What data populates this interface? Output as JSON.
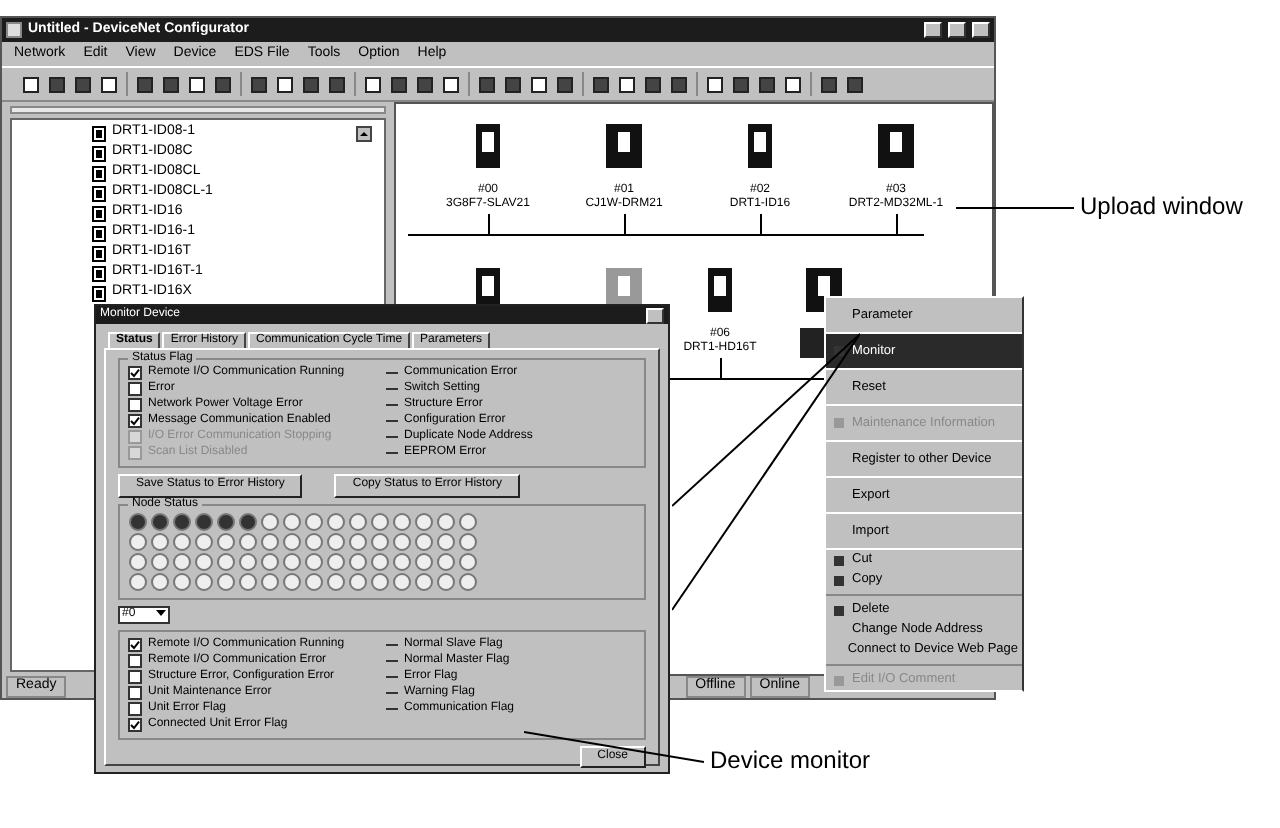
{
  "window": {
    "title": "Untitled - DeviceNet Configurator"
  },
  "menu": [
    "Network",
    "Edit",
    "View",
    "Device",
    "EDS File",
    "Tools",
    "Option",
    "Help"
  ],
  "tree": {
    "items": [
      {
        "label": "DRT1-ID08-1"
      },
      {
        "label": "DRT1-ID08C"
      },
      {
        "label": "DRT1-ID08CL"
      },
      {
        "label": "DRT1-ID08CL-1"
      },
      {
        "label": "DRT1-ID16"
      },
      {
        "label": "DRT1-ID16-1"
      },
      {
        "label": "DRT1-ID16T"
      },
      {
        "label": "DRT1-ID16T-1"
      },
      {
        "label": "DRT1-ID16X"
      }
    ]
  },
  "network": {
    "rows": [
      [
        {
          "address": "#00",
          "name": "3G8F7-SLAV21",
          "selected": false
        },
        {
          "address": "#01",
          "name": "CJ1W-DRM21",
          "selected": false
        },
        {
          "address": "#02",
          "name": "DRT1-ID16",
          "selected": false
        },
        {
          "address": "#03",
          "name": "DRT2-MD32ML-1",
          "selected": false
        }
      ],
      [
        {
          "selected": false
        },
        {
          "selected": false
        },
        {
          "address": "#06",
          "name": "DRT1-HD16T",
          "selected": false
        },
        {
          "selected": true
        }
      ]
    ]
  },
  "status_bar": [
    "Ready",
    "Offline",
    "Online"
  ],
  "monitor": {
    "title": "Monitor Device",
    "tabs": [
      {
        "label": "Status",
        "selected": true
      },
      {
        "label": "Error History",
        "selected": false
      },
      {
        "label": "Communication Cycle Time",
        "selected": false
      },
      {
        "label": "Parameters",
        "selected": false
      }
    ],
    "status_group": {
      "title": "Status Flag",
      "left": [
        {
          "label": "Remote I/O Communication Running",
          "checked": true,
          "disabled": false
        },
        {
          "label": "Error",
          "checked": false,
          "disabled": false
        },
        {
          "label": "Network Power Voltage Error",
          "checked": false,
          "disabled": false
        },
        {
          "label": "Message Communication Enabled",
          "checked": true,
          "disabled": false
        },
        {
          "label": "I/O Error Communication Stopping",
          "checked": false,
          "disabled": true
        },
        {
          "label": "Scan List Disabled",
          "checked": false,
          "disabled": true
        }
      ],
      "right": [
        "Communication Error",
        "Switch Setting",
        "Structure Error",
        "Configuration Error",
        "Duplicate Node Address",
        "EEPROM Error"
      ]
    },
    "buttons": [
      "Save Status to Error History",
      "Copy Status to Error History"
    ],
    "node_group": {
      "title": "Node Status"
    },
    "node_select": {
      "value": "#0"
    },
    "node_flags": {
      "left": [
        {
          "label": "Remote I/O Communication Running",
          "checked": true,
          "disabled": false
        },
        {
          "label": "Remote I/O Communication Error",
          "checked": false,
          "disabled": false
        },
        {
          "label": "Structure Error, Configuration Error",
          "checked": false,
          "disabled": false
        },
        {
          "label": "Unit Maintenance Error",
          "checked": false,
          "disabled": false
        },
        {
          "label": "Unit Error Flag",
          "checked": false,
          "disabled": false
        },
        {
          "label": "Connected Unit Error Flag",
          "checked": true,
          "disabled": false
        }
      ],
      "right": [
        "Normal Slave Flag",
        "Normal Master Flag",
        "Error Flag",
        "Warning Flag",
        "Communication Flag"
      ]
    },
    "close": "Close"
  },
  "context_menu": {
    "items": [
      {
        "label": "Parameter",
        "kind": "item",
        "icon": false,
        "selected": false,
        "disabled": false
      },
      {
        "label": "Monitor",
        "kind": "item",
        "icon": true,
        "selected": true,
        "disabled": false
      },
      {
        "label": "Reset",
        "kind": "item",
        "icon": false,
        "selected": false,
        "disabled": false
      },
      {
        "label": "Maintenance Information",
        "kind": "item",
        "icon": true,
        "selected": false,
        "disabled": true
      },
      {
        "label": "Register to other Device",
        "kind": "item",
        "icon": false,
        "selected": false,
        "disabled": false
      },
      {
        "label": "Export",
        "kind": "item",
        "icon": false,
        "selected": false,
        "disabled": false
      },
      {
        "label": "Import",
        "kind": "item",
        "icon": false,
        "selected": false,
        "disabled": false
      },
      {
        "label": "Cut",
        "kind": "compact",
        "icon": true,
        "selected": false,
        "disabled": false
      },
      {
        "label": "Copy",
        "kind": "compact",
        "icon": true,
        "selected": false,
        "disabled": false
      },
      {
        "kind": "separator"
      },
      {
        "label": "Delete",
        "kind": "compact",
        "icon": true,
        "selected": false,
        "disabled": false
      },
      {
        "label": "Change Node Address",
        "kind": "compact",
        "icon": false,
        "selected": false,
        "disabled": false
      },
      {
        "label": "Connect to Device Web Page",
        "kind": "compact",
        "icon": false,
        "selected": false,
        "disabled": false
      },
      {
        "kind": "separator"
      },
      {
        "label": "Edit I/O Comment",
        "kind": "compact",
        "icon": true,
        "selected": false,
        "disabled": true
      }
    ]
  },
  "callouts": [
    {
      "text": "Upload window"
    },
    {
      "text": "Device monitor"
    }
  ]
}
